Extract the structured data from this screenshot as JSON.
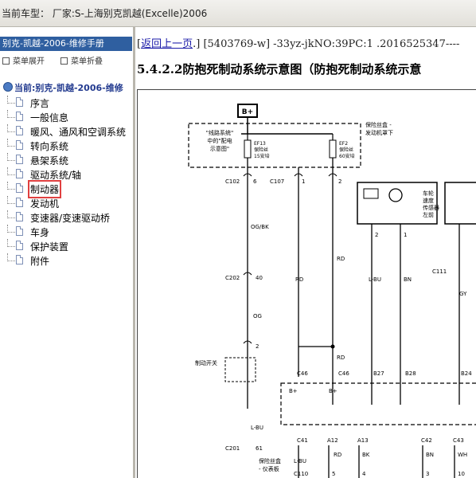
{
  "window": {
    "title": "当前车型：  厂家:S-上海别克凯越(Excelle)2006"
  },
  "sidebar": {
    "manual_title": "别克-凯越-2006-维修手册",
    "expand_label": "菜单展开",
    "collapse_label": "菜单折叠",
    "root_label": "当前:别克-凯越-2006-维修",
    "items": [
      {
        "label": "序言"
      },
      {
        "label": "一般信息"
      },
      {
        "label": "暖风、通风和空调系统"
      },
      {
        "label": "转向系统"
      },
      {
        "label": "悬架系统"
      },
      {
        "label": "驱动系统/轴"
      },
      {
        "label": "制动器",
        "selected": true
      },
      {
        "label": "发动机"
      },
      {
        "label": "变速器/变速驱动桥"
      },
      {
        "label": "车身"
      },
      {
        "label": "保护装置"
      },
      {
        "label": "附件"
      }
    ]
  },
  "content": {
    "back_link": "返回上一页",
    "doc_code": "[5403769-w] -33yz-jkNO:39PC:1 .2016525347----",
    "bracket_open": "[",
    "bracket_close": ".]",
    "heading": "5.4.2.2防抱死制动系统示意图（防抱死制动系统示意"
  },
  "diagram": {
    "power_label": "B+",
    "note_line1": "\"线路系统\"",
    "note_line2": "中的\"配电",
    "note_line3": "示意图\"",
    "fuse_box_label1": "保险丝盒 -",
    "fuse_box_label2": "发动机罩下",
    "fuse1_line1": "EF13",
    "fuse1_line2": "保险丝",
    "fuse1_line3": "15安培",
    "fuse2_line1": "EF2",
    "fuse2_line2": "保险丝",
    "fuse2_line3": "60安培",
    "connectors": {
      "c102": "C102",
      "c102_pin": "6",
      "c107": "C107",
      "c107_pin1": "1",
      "c107_pin2": "2",
      "c202": "C202",
      "c202_pin": "40",
      "c111": "C111",
      "c201": "C201",
      "c201_pin": "61"
    },
    "wires": {
      "og_bk": "OG/BK",
      "og": "OG",
      "rd1": "RD",
      "rd2": "RD",
      "rd3": "RD",
      "l_bu": "L-BU",
      "bn": "BN",
      "gy": "GY",
      "l_bu2": "L-BU",
      "bk": "BK",
      "bn2": "BN",
      "wh": "WH"
    },
    "sensor_label1": "车轮",
    "sensor_label2": "速度",
    "sensor_label3": "传感器",
    "sensor_label4": "左前",
    "sensor_pin2": "2",
    "sensor_pin1": "1",
    "switch_pin": "2",
    "brake_switch": "制动开关",
    "module_pins": [
      "C46",
      "C46",
      "B27",
      "B28",
      "B24"
    ],
    "module_bplus1": "B+",
    "module_bplus2": "B+",
    "bottom_pins": [
      "C41",
      "A12",
      "A13",
      "C42",
      "C43"
    ],
    "bottom_nums": [
      "5",
      "4",
      "3",
      "10"
    ],
    "bottom_conn": "C110",
    "fuse_panel1": "保险丝盒",
    "fuse_panel2": "- 仪表板"
  }
}
